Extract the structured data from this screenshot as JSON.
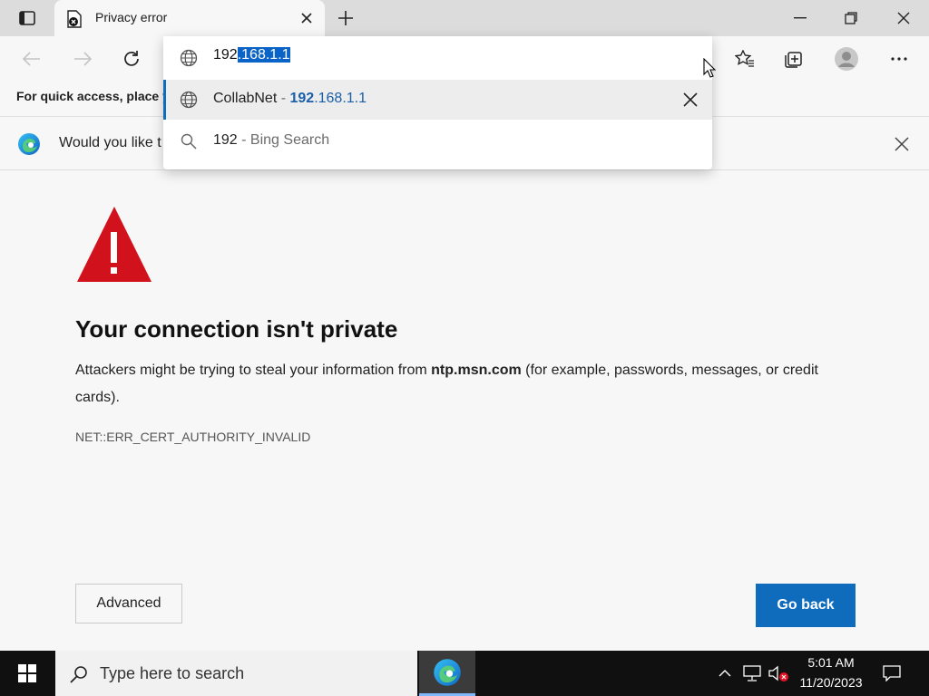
{
  "tab": {
    "title": "Privacy error"
  },
  "address_bar": {
    "typed": "192",
    "autocomplete": ".168.1.1"
  },
  "suggestions": [
    {
      "name": "CollabNet",
      "separator": " - ",
      "url_bold": "192",
      "url_rest": ".168.1.1"
    },
    {
      "query": "192",
      "separator": " - ",
      "engine": "Bing Search"
    }
  ],
  "favorites_bar": {
    "text": "For quick access, place y"
  },
  "infobar": {
    "text": "Would you like t"
  },
  "error_page": {
    "heading": "Your connection isn't private",
    "desc_before": "Attackers might be trying to steal your information from ",
    "desc_host": "ntp.msn.com",
    "desc_after": " (for example, passwords, messages, or credit cards).",
    "error_code": "NET::ERR_CERT_AUTHORITY_INVALID",
    "advanced_label": "Advanced",
    "go_back_label": "Go back"
  },
  "taskbar": {
    "search_placeholder": "Type here to search",
    "time": "5:01 AM",
    "date": "11/20/2023"
  },
  "colors": {
    "accent": "#0f6cbd",
    "warning_red": "#d1111b"
  }
}
